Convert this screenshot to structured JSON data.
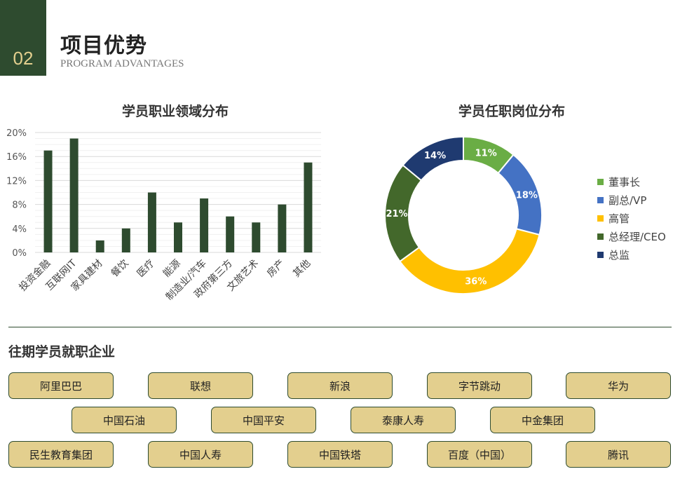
{
  "header": {
    "number": "02",
    "title": "项目优势",
    "subtitle": "PROGRAM ADVANTAGES"
  },
  "bar_chart": {
    "title": "学员职业领域分布"
  },
  "donut_chart": {
    "title": "学员任职岗位分布"
  },
  "chart_data": [
    {
      "type": "bar",
      "title": "学员职业领域分布",
      "categories": [
        "投资金融",
        "互联网IT",
        "家具建材",
        "餐饮",
        "医疗",
        "能源",
        "制造业/汽车",
        "政府第三方",
        "文旅艺术",
        "房产",
        "其他"
      ],
      "values": [
        17,
        19,
        2,
        4,
        10,
        5,
        9,
        6,
        5,
        8,
        15
      ],
      "unit": "%",
      "yticks": [
        "0%",
        "4%",
        "8%",
        "12%",
        "16%",
        "20%"
      ],
      "ylim": [
        0,
        20
      ],
      "grid": true,
      "color": "#2e4b2f"
    },
    {
      "type": "pie",
      "title": "学员任职岗位分布",
      "donut": true,
      "legend_position": "right",
      "slices": [
        {
          "name": "董事长",
          "value": 11,
          "label": "11%",
          "color": "#6aad45"
        },
        {
          "name": "副总/VP",
          "value": 18,
          "label": "18%",
          "color": "#4472c4"
        },
        {
          "name": "高管",
          "value": 36,
          "label": "36%",
          "color": "#ffc000"
        },
        {
          "name": "总经理/CEO",
          "value": 21,
          "label": "21%",
          "color": "#43682b"
        },
        {
          "name": "总监",
          "value": 14,
          "label": "14%",
          "color": "#1f3a70"
        }
      ]
    }
  ],
  "companies_section": {
    "title": "往期学员就职企业",
    "rows": [
      [
        "阿里巴巴",
        "联想",
        "新浪",
        "字节跳动",
        "华为"
      ],
      [
        "中国石油",
        "中国平安",
        "泰康人寿",
        "中金集团"
      ],
      [
        "民生教育集团",
        "中国人寿",
        "中国铁塔",
        "百度（中国）",
        "腾讯"
      ]
    ]
  }
}
